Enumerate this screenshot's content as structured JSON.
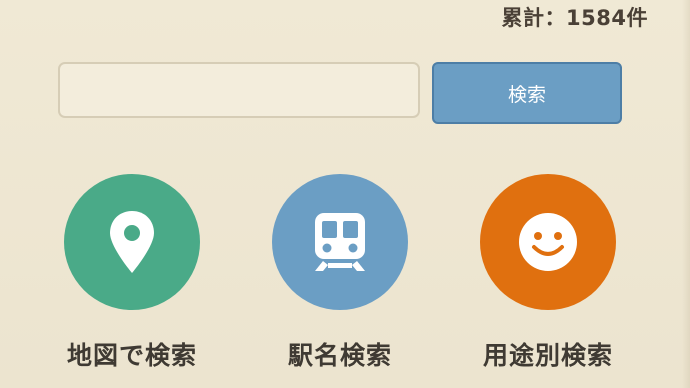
{
  "header": {
    "total_count": "累計：1584件"
  },
  "search": {
    "value": "",
    "placeholder": "",
    "button_label": "検索"
  },
  "options": [
    {
      "label": "地図で検索",
      "icon": "map-pin-icon",
      "color": "#4aaa88"
    },
    {
      "label": "駅名検索",
      "icon": "train-icon",
      "color": "#6b9ec4"
    },
    {
      "label": "用途別検索",
      "icon": "smiley-icon",
      "color": "#e0700f"
    }
  ],
  "colors": {
    "background": "#efe8d3",
    "text": "#3f3a33",
    "button": "#6b9ec4"
  }
}
